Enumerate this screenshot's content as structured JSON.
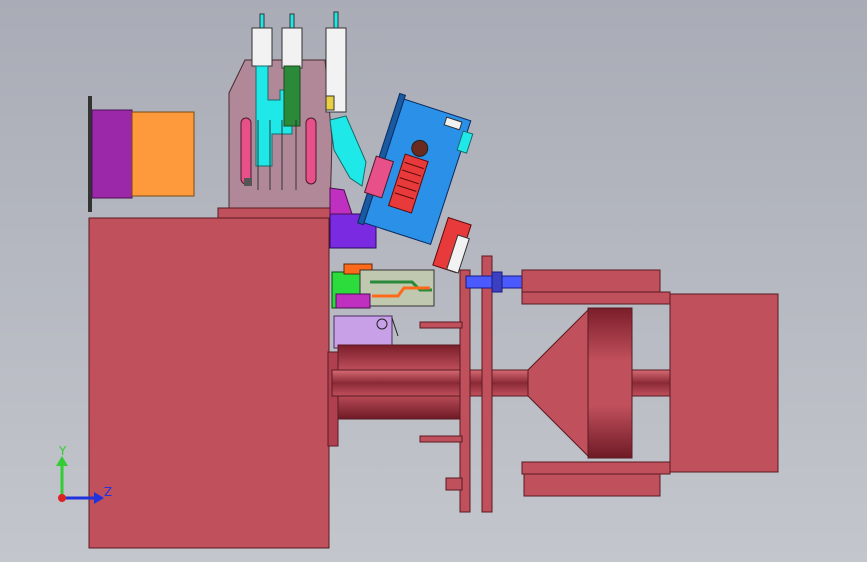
{
  "view": {
    "background_top": "#a9acb6",
    "background_bottom": "#c3c6cc"
  },
  "triad": {
    "y_label": "Y",
    "z_label": "Z",
    "y_color": "#33cc33",
    "z_color": "#2233dd",
    "origin_color": "#dd2222"
  },
  "colors": {
    "body": "#c0505c",
    "body_dark": "#8a2a36",
    "purple": "#9b28a8",
    "orange": "#ff9a3c",
    "cyan": "#1fe8e8",
    "blue": "#2a90e8",
    "violet": "#7a2ae0",
    "pink": "#e8508a",
    "green": "#2bdc3c",
    "mauve": "#b08898",
    "white": "#f2f2f2"
  }
}
